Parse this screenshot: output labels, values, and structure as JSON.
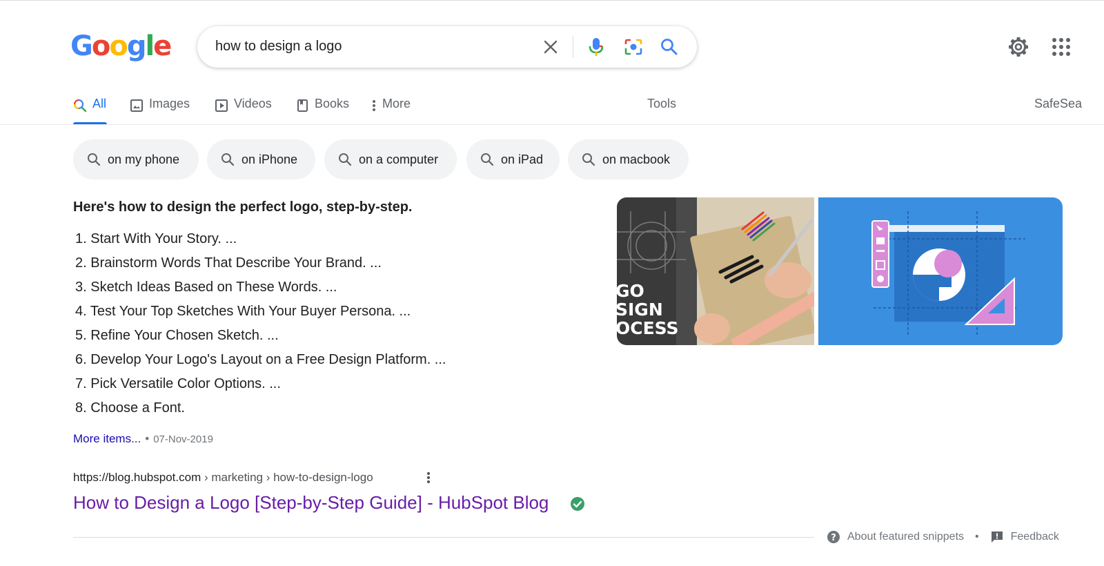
{
  "header": {
    "logo_letters": [
      "G",
      "o",
      "o",
      "g",
      "l",
      "e"
    ],
    "logo_colors": [
      "#4285f4",
      "#ea4335",
      "#fbbc05",
      "#4285f4",
      "#34a853",
      "#ea4335"
    ],
    "search_query": "how to design a logo",
    "icons": [
      "close-icon",
      "mic-icon",
      "camera-icon",
      "search-icon",
      "gear-icon",
      "apps-grid-icon"
    ]
  },
  "tabs": [
    {
      "label": "All",
      "icon": "search-icon",
      "active": true
    },
    {
      "label": "Images",
      "icon": "image-icon"
    },
    {
      "label": "Videos",
      "icon": "play-icon"
    },
    {
      "label": "Books",
      "icon": "book-icon"
    },
    {
      "label": "More",
      "icon": "more-vertical-icon"
    }
  ],
  "tools_label": "Tools",
  "safesearch_label": "SafeSea",
  "chips": [
    "on my phone",
    "on iPhone",
    "on a computer",
    "on iPad",
    "on macbook"
  ],
  "snippet": {
    "heading": "Here's how to design the perfect logo, step-by-step.",
    "steps": [
      "1. Start With Your Story. ...",
      "2. Brainstorm Words That Describe Your Brand. ...",
      "3. Sketch Ideas Based on These Words. ...",
      "4. Test Your Top Sketches With Your Buyer Persona. ...",
      "5. Refine Your Chosen Sketch. ...",
      "6. Develop Your Logo's Layout on a Free Design Platform. ...",
      "7. Pick Versatile Color Options. ...",
      "8. Choose a Font."
    ],
    "more_items": "More items...",
    "separator": "•",
    "date": "07-Nov-2019",
    "image1_text": [
      "GO",
      "SIGN",
      "OCESS"
    ]
  },
  "result": {
    "url_domain": "https://blog.hubspot.com",
    "url_path": " › marketing › how-to-design-logo",
    "title": "How to Design a Logo [Step-by-Step Guide] - HubSpot Blog"
  },
  "footer": {
    "about_snippets": "About featured snippets",
    "separator": "•",
    "feedback": "Feedback"
  },
  "colors": {
    "link_blue": "#1a0dab",
    "visited_purple": "#681da8",
    "accent_blue": "#1a73e8",
    "verified_green": "#34a853"
  }
}
